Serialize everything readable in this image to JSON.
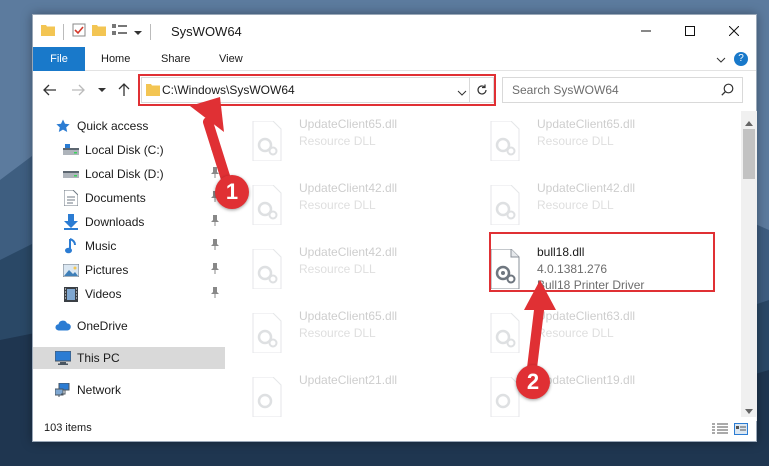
{
  "window": {
    "title": "SysWOW64"
  },
  "ribbon": {
    "tabs": [
      "File",
      "Home",
      "Share",
      "View"
    ],
    "help_label": "?"
  },
  "nav": {
    "address_path": "C:\\Windows\\SysWOW64",
    "search_placeholder": "Search SysWOW64"
  },
  "sidebar": {
    "items": [
      {
        "label": "Quick access",
        "icon": "star-icon",
        "pinned": false
      },
      {
        "label": "Local Disk (C:)",
        "icon": "drive-icon",
        "pinned": true
      },
      {
        "label": "Local Disk (D:)",
        "icon": "drive-icon",
        "pinned": true
      },
      {
        "label": "Documents",
        "icon": "documents-icon",
        "pinned": true
      },
      {
        "label": "Downloads",
        "icon": "download-icon",
        "pinned": true
      },
      {
        "label": "Music",
        "icon": "music-icon",
        "pinned": true
      },
      {
        "label": "Pictures",
        "icon": "pictures-icon",
        "pinned": true
      },
      {
        "label": "Videos",
        "icon": "videos-icon",
        "pinned": true
      },
      {
        "label": "OneDrive",
        "icon": "cloud-icon",
        "pinned": false
      },
      {
        "label": "This PC",
        "icon": "computer-icon",
        "pinned": false,
        "selected": true
      },
      {
        "label": "Network",
        "icon": "network-icon",
        "pinned": false
      }
    ]
  },
  "files": [
    {
      "name": "UpdateClient65.dll",
      "line1": "Resource DLL",
      "line2": "",
      "dim": true
    },
    {
      "name": "UpdateClient65.dll",
      "line1": "Resource DLL",
      "line2": "",
      "dim": true
    },
    {
      "name": "UpdateClient42.dll",
      "line1": "Resource DLL",
      "line2": "",
      "dim": true
    },
    {
      "name": "UpdateClient42.dll",
      "line1": "Resource DLL",
      "line2": "",
      "dim": true
    },
    {
      "name": "UpdateClient42.dll",
      "line1": "Resource DLL",
      "line2": "",
      "dim": true
    },
    {
      "name": "bull18.dll",
      "line1": "4.0.1381.276",
      "line2": "Bull18 Printer Driver",
      "dim": false
    },
    {
      "name": "UpdateClient65.dll",
      "line1": "Resource DLL",
      "line2": "",
      "dim": true
    },
    {
      "name": "UpdateClient63.dll",
      "line1": "Resource DLL",
      "line2": "",
      "dim": true
    },
    {
      "name": "UpdateClient21.dll",
      "line1": "",
      "line2": "",
      "dim": true
    },
    {
      "name": "UpdateClient19.dll",
      "line1": "",
      "line2": "",
      "dim": true
    }
  ],
  "status": {
    "item_count": "103 items"
  },
  "callouts": {
    "step1": "1",
    "step2": "2"
  },
  "colors": {
    "accent": "#1979ca",
    "highlight": "#e03034",
    "selected_bg": "#d9d9d9"
  }
}
